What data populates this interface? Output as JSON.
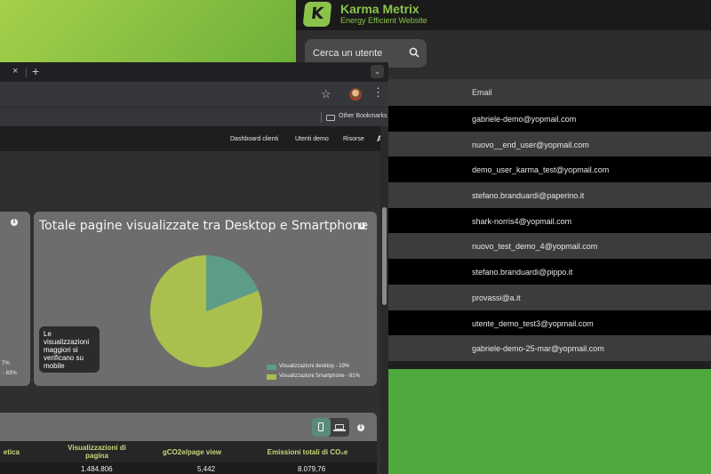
{
  "karma": {
    "brand": "Karma Metrix",
    "logo_letter": "K",
    "tagline": "Energy Efficient Website",
    "search_placeholder": "Cerca un utente",
    "column_email": "Email",
    "emails": [
      "gabriele-demo@yopmail.com",
      "nuovo__end_user@yopmail.com",
      "demo_user_karma_test@yopmail.com",
      "stefano.branduardi@paperino.it",
      "shark-norris4@yopmail.com",
      "nuovo_test_demo_4@yopmail.com",
      "stefano.branduardi@pippo.it",
      "provassi@a.it",
      "utente_demo_test3@yopmail.com",
      "gabriele-demo-25-mar@yopmail.com"
    ]
  },
  "browser": {
    "tab_close": "×",
    "new_tab": "+",
    "tab_dropdown": "⌄",
    "star": "☆",
    "menu": "⋮",
    "bookmarks_label": "Other Bookmarks"
  },
  "site_nav": {
    "items": [
      "Dashboard clienti",
      "Utenti demo",
      "Risorse",
      "A"
    ]
  },
  "left_card": {
    "line1": "7%",
    "line2": "-  83%"
  },
  "main_card": {
    "title": "Totale pagine visualizzate tra Desktop e Smartphone",
    "callout": "Le visualizzazioni maggiori si verificano su mobile",
    "info": "i"
  },
  "chart_data": {
    "type": "pie",
    "categories": [
      "Visualizzazioni desktop",
      "Visualizzazioni Smartphone"
    ],
    "values": [
      19,
      81
    ],
    "colors": [
      "#5e9c8a",
      "#a9c04e"
    ],
    "legend_labels": [
      "Visualizzazioni desktop -  19%",
      "Visualizzazioni Smartphone -  81%"
    ],
    "legend_position": "bottom-right"
  },
  "table_card": {
    "headers": [
      "etica",
      "Visualizzazioni di pagina",
      "gCO2e/page view",
      "Emissioni totali di CO₂e"
    ],
    "row": [
      "1.484.806",
      "5,442",
      "8.079,76"
    ]
  }
}
